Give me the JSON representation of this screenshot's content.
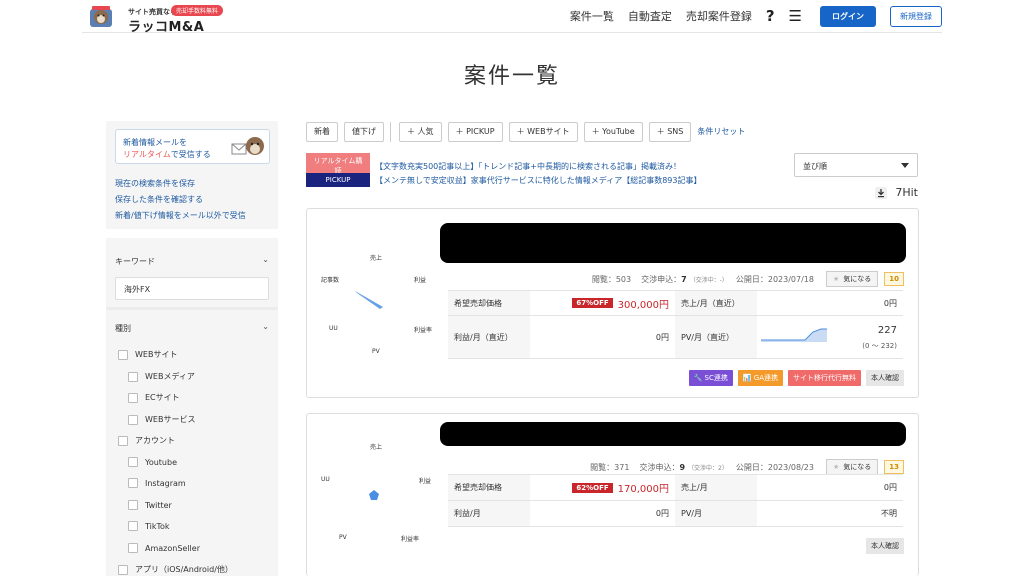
{
  "header": {
    "logo_small": "サイト売買なら",
    "logo_badge": "売却手数料無料",
    "logo_main": "ラッコM&A",
    "nav": [
      "案件一覧",
      "自動査定",
      "売却案件登録"
    ],
    "help_icon": "?",
    "menu_icon": "☰",
    "login": "ログイン",
    "register": "新規登録"
  },
  "page_title": "案件一覧",
  "sidebar": {
    "mail_line1": "新着情報メールを",
    "mail_line2_highlight": "リアルタイム",
    "mail_line2_rest": "で受信する",
    "links": [
      "現在の検索条件を保存",
      "保存した条件を確認する",
      "新着/値下げ情報をメール以外で受信"
    ],
    "keyword_title": "キーワード",
    "keyword_value": "海外FX",
    "type_title": "種別",
    "types": [
      {
        "label": "WEBサイト",
        "level": 0
      },
      {
        "label": "WEBメディア",
        "level": 1
      },
      {
        "label": "ECサイト",
        "level": 1
      },
      {
        "label": "WEBサービス",
        "level": 1
      },
      {
        "label": "アカウント",
        "level": 0
      },
      {
        "label": "Youtube",
        "level": 1
      },
      {
        "label": "Instagram",
        "level": 1
      },
      {
        "label": "Twitter",
        "level": 1
      },
      {
        "label": "TikTok",
        "level": 1
      },
      {
        "label": "AmazonSeller",
        "level": 1
      },
      {
        "label": "アプリ（iOS/Android/他）",
        "level": 0
      }
    ]
  },
  "filters": {
    "chips": [
      "新着",
      "値下げ"
    ],
    "plus_chips": [
      "＋ 人気",
      "＋ PICKUP",
      "＋ WEBサイト",
      "＋ YouTube",
      "＋ SNS"
    ],
    "reset": "条件リセット"
  },
  "promos": [
    {
      "tag": "リアルタイム購読",
      "text": "【文字数充実500記事以上】「トレンド記事+中長期的に検索される記事」掲載済み！",
      "color": "#f07e7e"
    },
    {
      "tag": "PICKUP",
      "text": "【メンテ無しで安定収益】家事代行サービスに特化した情報メディア【総記事数893記事】",
      "color": "#1a237e"
    }
  ],
  "sort": {
    "label": "並び順"
  },
  "hit_count": "7Hit",
  "cards": [
    {
      "radar_labels": {
        "top": "売上",
        "left_top": "記事数",
        "right_top": "利益",
        "left_bottom": "UU",
        "right_bottom": "利益率",
        "bottom": "PV"
      },
      "views_label": "閲覧：503",
      "nego_label": "交渉申込：",
      "nego_count": "7",
      "nego_sub": "（交渉中：-）",
      "published": "公開日：2023/07/18",
      "fav": "気になる",
      "fav_count": "10",
      "rows": [
        {
          "l1": "希望売却価格",
          "badge": "67%OFF",
          "v1": "300,000円",
          "l2": "売上/月（直近）",
          "v2": "0円"
        },
        {
          "l1": "利益/月（直近）",
          "v1": "0円",
          "l2": "PV/月（直近）",
          "v2": "227",
          "v2_sub": "(0 〜 232)"
        }
      ],
      "tags": [
        {
          "text": "🔧 SC連携",
          "color": "#7a4fd6"
        },
        {
          "text": "📊 GA連携",
          "color": "#f39a2a"
        },
        {
          "text": "サイト移行代行無料",
          "color": "#f06a6a"
        },
        {
          "text": "本人確認",
          "color": "gray"
        }
      ]
    },
    {
      "radar_labels": {
        "top": "売上",
        "left_top": "UU",
        "right_top": "利益",
        "bottom_left": "PV",
        "bottom_right": "利益率"
      },
      "views_label": "閲覧：371",
      "nego_label": "交渉申込：",
      "nego_count": "9",
      "nego_sub": "（交渉中：2）",
      "published": "公開日：2023/08/23",
      "fav": "気になる",
      "fav_count": "13",
      "rows": [
        {
          "l1": "希望売却価格",
          "badge": "62%OFF",
          "v1": "170,000円",
          "l2": "売上/月",
          "v2": "0円"
        },
        {
          "l1": "利益/月",
          "v1": "0円",
          "l2": "PV/月",
          "v2": "不明"
        }
      ],
      "tags": [
        {
          "text": "本人確認",
          "color": "gray"
        }
      ]
    }
  ]
}
